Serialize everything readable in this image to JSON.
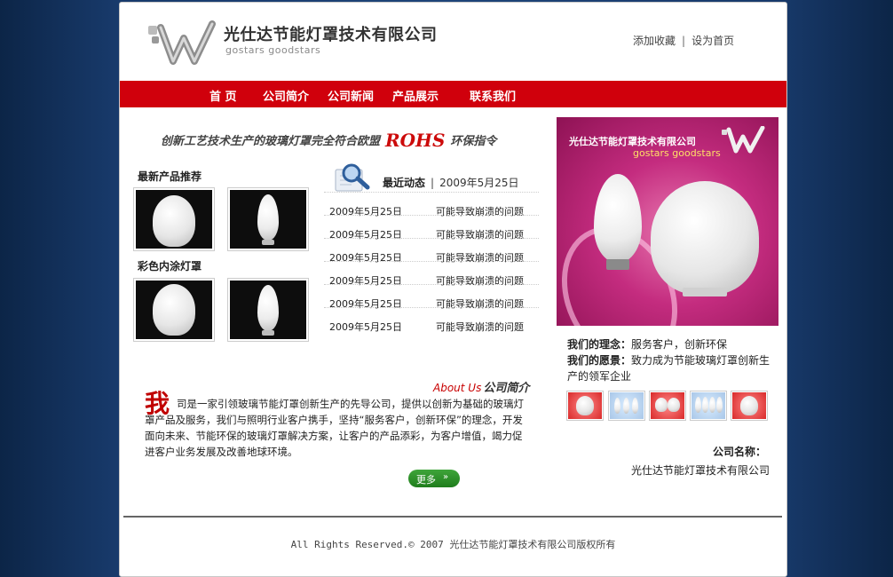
{
  "header": {
    "company_name": "光仕达节能灯罩技术有限公司",
    "company_sub": "gostars goodstars",
    "links": [
      "添加收藏",
      "设为首页"
    ]
  },
  "nav": [
    "首 页",
    "公司简介",
    "公司新闻",
    "产品展示",
    "联系我们"
  ],
  "slogan": {
    "before": "创新工艺技术生产的玻璃灯罩完全符合欧盟",
    "rohs": "ROHS",
    "after": "环保指令"
  },
  "products": {
    "latest_title": "最新产品推荐",
    "colored_title": "彩色内涂灯罩"
  },
  "news": {
    "title": "最近动态",
    "date": "2009年5月25日",
    "items": [
      {
        "date": "2009年5月25日",
        "title": "可能导致崩溃的问题"
      },
      {
        "date": "2009年5月25日",
        "title": "可能导致崩溃的问题"
      },
      {
        "date": "2009年5月25日",
        "title": "可能导致崩溃的问题"
      },
      {
        "date": "2009年5月25日",
        "title": "可能导致崩溃的问题"
      },
      {
        "date": "2009年5月25日",
        "title": "可能导致崩溃的问题"
      },
      {
        "date": "2009年5月25日",
        "title": "可能导致崩溃的问题"
      }
    ]
  },
  "about": {
    "title_en": "About Us",
    "title_cn": "公司简介",
    "dropcap": "我",
    "text": "司是一家引领玻璃节能灯罩创新生产的先导公司，提供以创新为基础的玻璃灯罩产品及服务，我们与照明行业客户携手，坚持“服务客户，创新环保”的理念，开发面向未来、节能环保的玻璃灯罩解决方案，让客户的产品添彩，为客户增值，竭力促进客户业务发展及改善地球环境。",
    "more": "更多"
  },
  "banner": {
    "name": "光仕达节能灯罩技术有限公司",
    "sub": "gostars goodstars"
  },
  "philosophy": {
    "idea_label": "我们的理念：",
    "idea": "服务客户，创新环保",
    "vision_label": "我们的愿景：",
    "vision": "致力成为节能玻璃灯罩创新生产的领军企业"
  },
  "company": {
    "label": "公司名称：",
    "name": "光仕达节能灯罩技术有限公司"
  },
  "footer": "All Rights Reserved.© 2007 光仕达节能灯罩技术有限公司版权所有",
  "colors": {
    "nav_red": "#d0000c",
    "banner_pink": "#c42c7f",
    "more_green": "#2a8f26"
  }
}
